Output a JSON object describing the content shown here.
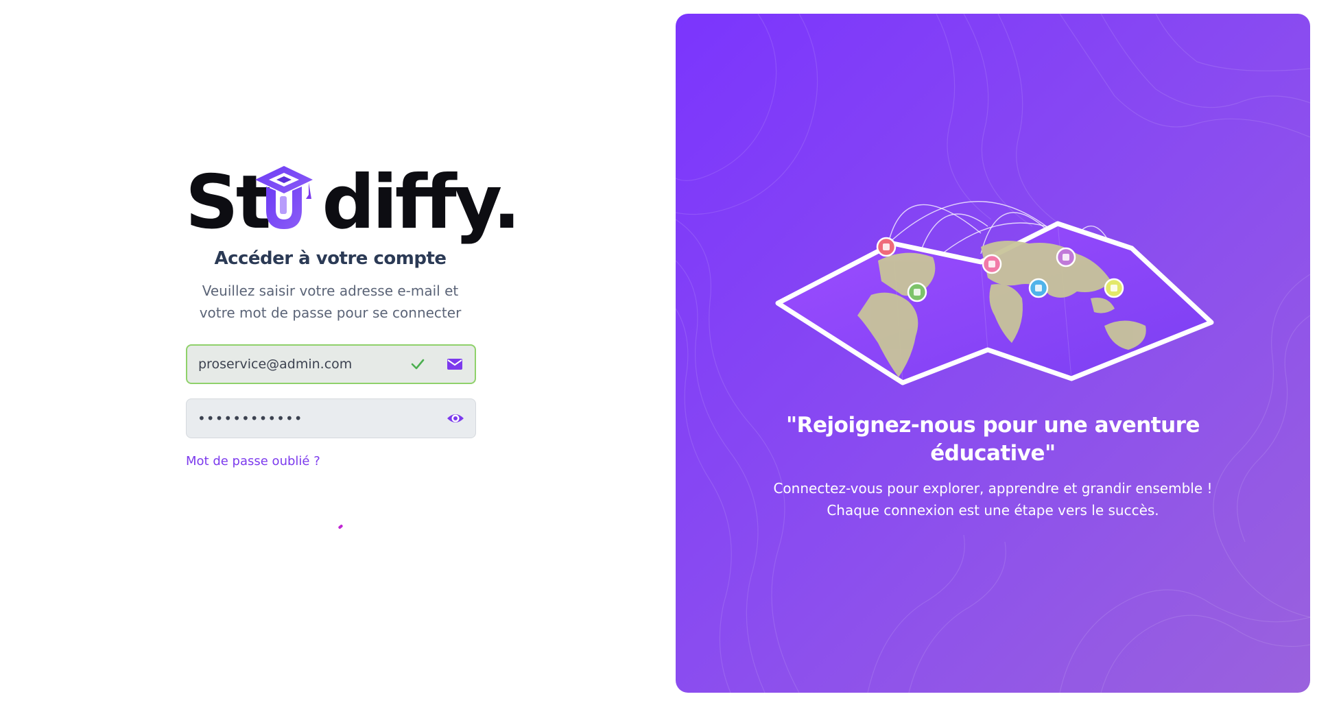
{
  "brand": {
    "logo_text_left": "St",
    "logo_text_right": "diffy.",
    "logo_icon": "graduation-cap-u-icon"
  },
  "login": {
    "title": "Accéder à votre compte",
    "subtitle_line1": "Veuillez saisir votre adresse e-mail et",
    "subtitle_line2": "votre mot de passe pour se connecter",
    "email_value": "proservice@admin.com",
    "password_value": "••••••••••••",
    "forgot_link": "Mot de passe oublié ?"
  },
  "hero": {
    "quote_line1": "\"Rejoignez-nous pour une aventure",
    "quote_line2": "éducative\"",
    "desc_line1": "Connectez-vous pour explorer, apprendre et grandir ensemble !",
    "desc_line2": "Chaque connexion est une étape vers le succès.",
    "illustration": "world-map-icon"
  },
  "colors": {
    "accent": "#7c3aed",
    "valid": "#8fd16a",
    "panel_start": "#7b35fd",
    "panel_end": "#9a62dd"
  }
}
